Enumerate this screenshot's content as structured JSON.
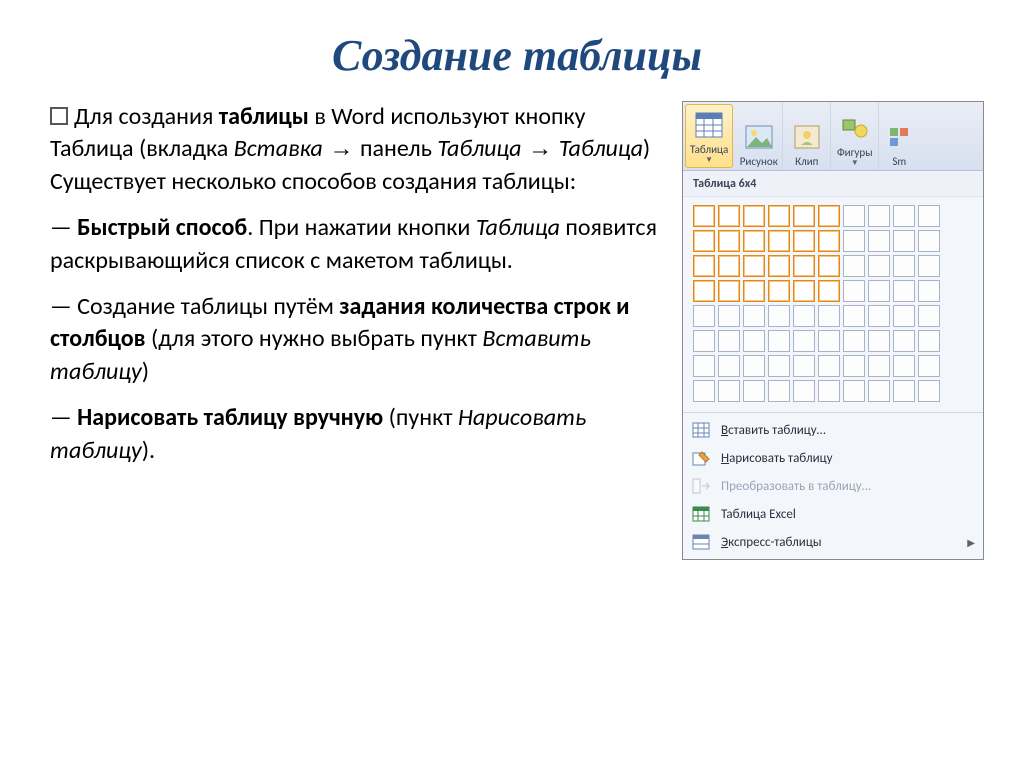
{
  "title": "Создание таблицы",
  "para1": {
    "pre": "Для создания ",
    "bold1": "таблицы",
    "mid1": " в Word используют кнопку Таблица (вкладка ",
    "ital1": "Вставка",
    "mid2": " панель ",
    "ital2": "Таблица",
    "mid3": "  ",
    "ital3": "Таблица",
    "post": ") Существует несколько способов создания таблицы:"
  },
  "para2": {
    "dash": "— ",
    "bold": "Быстрый способ",
    "mid1": ". При нажатии кнопки ",
    "ital": "Таблица",
    "post": "  появится раскрывающийся список с макетом таблицы."
  },
  "para3": {
    "dash": "— Создание таблицы путём ",
    "bold": "задания количества строк и столбцов",
    "mid": " (для этого нужно выбрать пункт ",
    "ital": "Вставить таблицу",
    "post": ")"
  },
  "para4": {
    "dash": "— ",
    "bold": "Нарисовать таблицу вручную",
    "mid": " (пункт ",
    "ital": "Нарисовать таблицу",
    "post": ")."
  },
  "ribbon": {
    "table": "Таблица",
    "picture": "Рисунок",
    "clip": "Клип",
    "shapes": "Фигуры",
    "smart": "Sm"
  },
  "dropdown": {
    "header": "Таблица 6x4",
    "insert": "Вставить таблицу...",
    "draw": "Нарисовать таблицу",
    "convert": "Преобразовать в таблицу...",
    "excel": "Таблица Excel",
    "express": "Экспресс-таблицы"
  }
}
